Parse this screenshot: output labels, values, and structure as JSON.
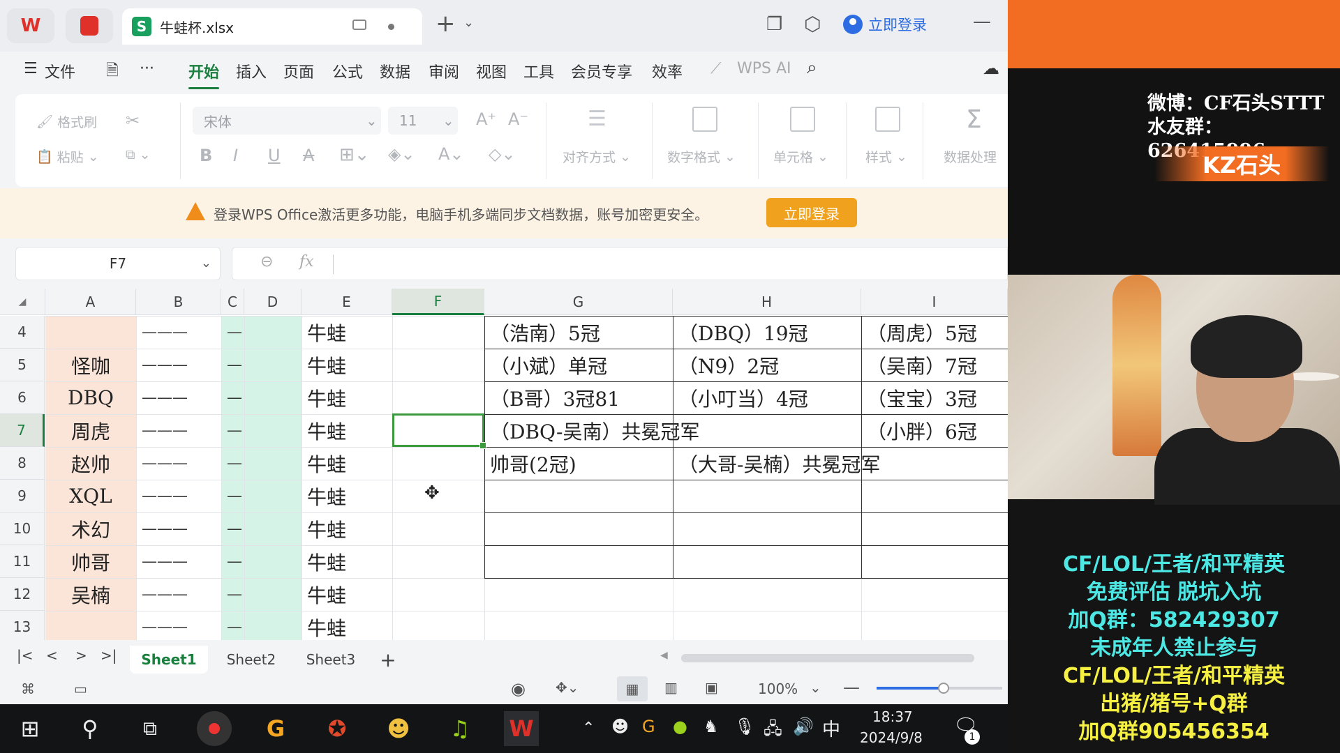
{
  "titlebar": {
    "file_name": "牛蛙杯.xlsx",
    "login": "立即登录"
  },
  "menu": {
    "items": [
      "文件",
      "开始",
      "插入",
      "页面",
      "公式",
      "数据",
      "审阅",
      "视图",
      "工具",
      "会员专享",
      "效率",
      "WPS AI"
    ],
    "active": "开始"
  },
  "ribbon": {
    "format_painter": "格式刷",
    "paste": "粘贴",
    "font_name": "宋体",
    "font_size": "11",
    "align": "对齐方式",
    "number_format": "数字格式",
    "cell": "单元格",
    "style": "样式",
    "data_process": "数据处理"
  },
  "banner": {
    "text": "登录WPS Office激活更多功能，电脑手机多端同步文档数据，账号加密更安全。",
    "button": "立即登录"
  },
  "namebox": {
    "value": "F7"
  },
  "formula": {
    "fx": "fx",
    "value": ""
  },
  "columns": [
    "A",
    "B",
    "C",
    "D",
    "E",
    "F",
    "G",
    "H",
    "I"
  ],
  "rows": [
    {
      "n": "4",
      "a": "",
      "b": "———",
      "c": "—",
      "e": "牛蛙",
      "g": "（浩南）5冠",
      "h": "（DBQ）19冠",
      "i": "（周虎）5冠"
    },
    {
      "n": "5",
      "a": "怪咖",
      "b": "———",
      "c": "—",
      "e": "牛蛙",
      "g": "（小斌）单冠",
      "h": "（N9）2冠",
      "i": "（吴南）7冠"
    },
    {
      "n": "6",
      "a": "DBQ",
      "b": "———",
      "c": "—",
      "e": "牛蛙",
      "g": "（B哥）3冠81",
      "h": "（小叮当）4冠",
      "i": "（宝宝）3冠"
    },
    {
      "n": "7",
      "a": "周虎",
      "b": "———",
      "c": "—",
      "e": "牛蛙",
      "g": "（DBQ-吴南）共冕冠军",
      "h": "",
      "i": "（小胖）6冠"
    },
    {
      "n": "8",
      "a": "赵帅",
      "b": "———",
      "c": "—",
      "e": "牛蛙",
      "g": "帅哥(2冠)",
      "h": "（大哥-吴楠）共冕冠军",
      "i": ""
    },
    {
      "n": "9",
      "a": "XQL",
      "b": "———",
      "c": "—",
      "e": "牛蛙",
      "g": "",
      "h": "",
      "i": ""
    },
    {
      "n": "10",
      "a": "术幻",
      "b": "———",
      "c": "—",
      "e": "牛蛙",
      "g": "",
      "h": "",
      "i": ""
    },
    {
      "n": "11",
      "a": "帅哥",
      "b": "———",
      "c": "—",
      "e": "牛蛙",
      "g": "",
      "h": "",
      "i": ""
    },
    {
      "n": "12",
      "a": "吴楠",
      "b": "———",
      "c": "—",
      "e": "牛蛙",
      "g": "",
      "h": "",
      "i": ""
    },
    {
      "n": "13",
      "a": "",
      "b": "———",
      "c": "—",
      "e": "牛蛙",
      "g": "",
      "h": "",
      "i": ""
    }
  ],
  "sheets": {
    "tabs": [
      "Sheet1",
      "Sheet2",
      "Sheet3"
    ],
    "active": "Sheet1",
    "add": "+"
  },
  "status": {
    "zoom": "100%"
  },
  "taskbar": {
    "time": "18:37",
    "date": "2024/9/8",
    "ime": "中",
    "notif_count": "1"
  },
  "overlay": {
    "weibo": "微博：CF石头STTT",
    "fan_group": "水友群：626415996",
    "streamer": "KZ石头",
    "promo": [
      "CF/LOL/王者/和平精英",
      "免费评估  脱坑入坑",
      "加Q群：582429307",
      "未成年人禁止参与",
      "CF/LOL/王者/和平精英",
      "出猪/猪号+Q群",
      "加Q群905456354"
    ]
  },
  "colors": {
    "accent": "#1a7f3e",
    "fill_a": "#fbe5d9",
    "fill_c": "#d5f3e7",
    "banner_btn": "#f0a21e",
    "overlay_orange": "#f26d22"
  }
}
